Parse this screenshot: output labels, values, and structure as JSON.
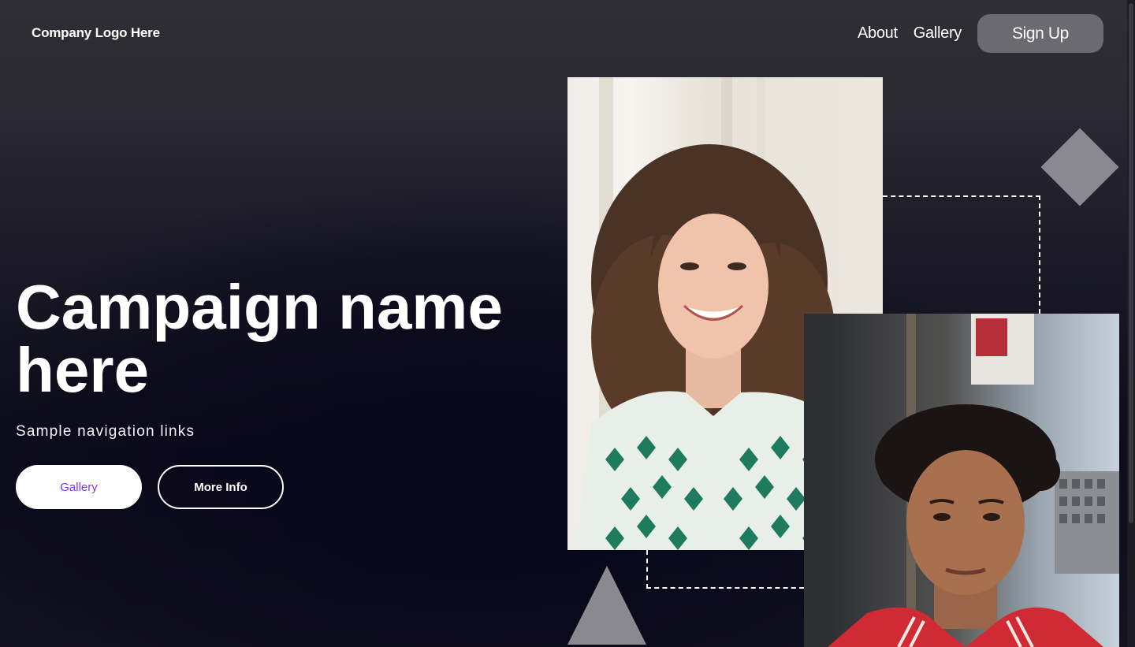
{
  "header": {
    "logo": "Company Logo Here",
    "nav": {
      "about": "About",
      "gallery": "Gallery",
      "signup": "Sign Up"
    }
  },
  "hero": {
    "title": "Campaign name here",
    "subtitle": "Sample navigation links",
    "buttons": {
      "gallery": "Gallery",
      "more_info": "More Info"
    }
  },
  "images": [
    {
      "name": "portrait-woman",
      "description": "smiling woman with curly hair in green patterned shirt"
    },
    {
      "name": "portrait-man",
      "description": "young man with curly hair in red jacket, city background"
    }
  ],
  "colors": {
    "gallery_button_text": "#7c3aed",
    "signup_button_bg": "#6b6a72",
    "shape_gray": "#8a898f"
  }
}
